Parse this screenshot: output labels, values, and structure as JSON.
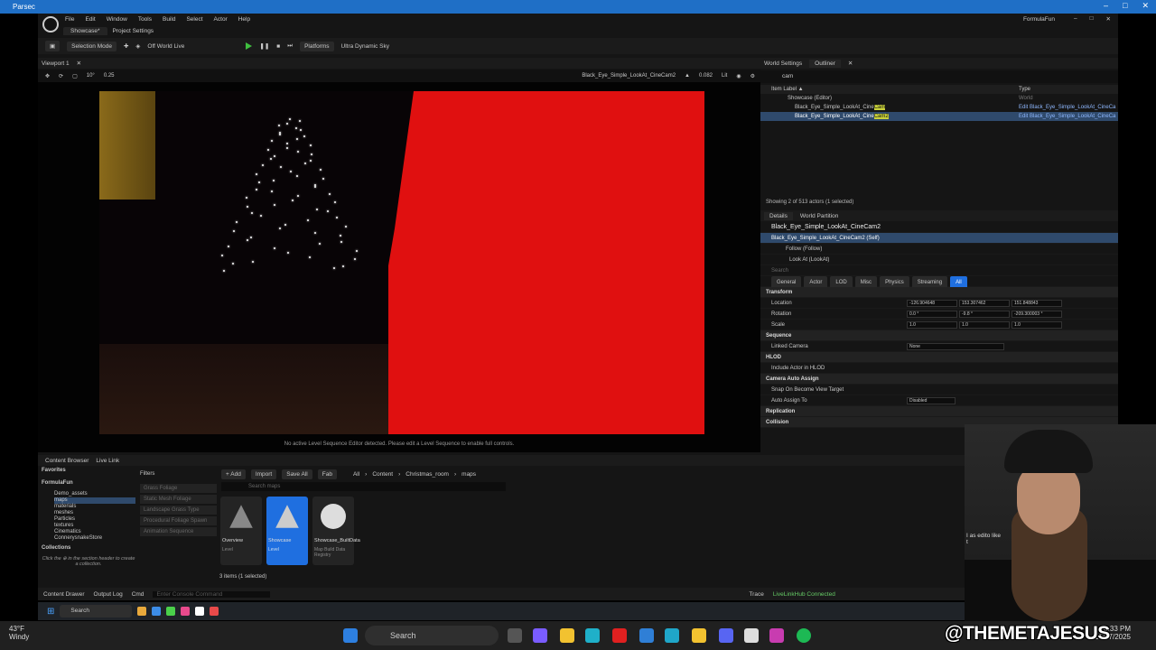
{
  "parsec": {
    "title": "Parsec",
    "controls": [
      "–",
      "□",
      "✕"
    ]
  },
  "menu": {
    "items": [
      "File",
      "Edit",
      "Window",
      "Tools",
      "Build",
      "Select",
      "Actor",
      "Help"
    ],
    "project": "FormulaFun"
  },
  "level_tab": "Showcase*",
  "project_settings": "Project Settings",
  "toolbar": {
    "selection_mode": "Selection Mode",
    "world": "Off World Live",
    "platforms": "Platforms",
    "sky": "Ultra Dynamic Sky"
  },
  "viewport": {
    "tab": "Viewport 1",
    "camera_name": "Black_Eye_Simple_LookAt_CineCam2",
    "fov_value": "0.082",
    "lit": "Lit",
    "grid_snap": "10°",
    "scale_snap": "0.25",
    "message": "No active Level Sequence Editor detected. Please edit a Level Sequence to enable full controls."
  },
  "right_tabs": {
    "world_settings": "World Settings",
    "outliner": "Outliner"
  },
  "outliner": {
    "search": "cam",
    "col_label": "Item Label ▲",
    "col_type": "Type",
    "rows": [
      {
        "label": "Showcase (Editor)",
        "type": "World",
        "selected": false
      },
      {
        "label": "Black_Eye_Simple_LookAt_Cine",
        "highlight": "Cam",
        "type": "Edit Black_Eye_Simple_LookAt_CineCa",
        "selected": false
      },
      {
        "label": "Black_Eye_Simple_LookAt_Cine",
        "highlight": "Cam2",
        "type": "Edit Black_Eye_Simple_LookAt_CineCa",
        "selected": true
      }
    ],
    "footer": "Showing 2 of 513 actors (1 selected)"
  },
  "details": {
    "tab": "Details",
    "tab2": "World Partition",
    "title": "Black_Eye_Simple_LookAt_CineCam2",
    "add": "+ Add",
    "self": "Black_Eye_Simple_LookAt_CineCam2 (Self)",
    "follow": "Follow (Follow)",
    "lookat": "Look At (LookAt)",
    "edit_cpp": "Edit in C++",
    "search_placeholder": "Search",
    "categories": [
      "General",
      "Actor",
      "LOD",
      "Misc",
      "Physics",
      "Streaming",
      "All"
    ],
    "transform": "Transform",
    "location_label": "Location",
    "location": [
      "-126.904648",
      "153.307462",
      "151.848843"
    ],
    "rotation_label": "Rotation",
    "rotation": [
      "0.0 °",
      "-9.8 °",
      "-209.300003 °"
    ],
    "scale_label": "Scale",
    "scale": [
      "1.0",
      "1.0",
      "1.0"
    ],
    "sequence": "Sequence",
    "linked_camera_label": "Linked Camera",
    "linked_camera": "None",
    "hlod": "HLOD",
    "include_hlod": "Include Actor in HLOD",
    "auto_assign": "Camera Auto Assign",
    "snap_label": "Snap On Become View Target",
    "assign_to_label": "Auto Assign To",
    "assign_to": "Disabled",
    "replication": "Replication",
    "collision": "Collision"
  },
  "content_browser": {
    "tab": "Content Browser",
    "tab2": "Live Link",
    "favorites": "Favorites",
    "root": "FormulaFun",
    "tree": [
      "Demo_assets",
      "maps",
      "materials",
      "meshes",
      "Particles",
      "textures",
      "Cinematics",
      "ConnerysnakeStore"
    ],
    "collections": "Collections",
    "collections_hint": "Click the ⊕ in the section header to create a collection.",
    "filters": "Filters",
    "filter_items": [
      "Grass Foliage",
      "Static Mesh Foliage",
      "Landscape Grass Type",
      "Procedural Foliage Spawn",
      "Animation Sequence"
    ],
    "add": "+ Add",
    "import": "Import",
    "save_all": "Save All",
    "fab": "Fab",
    "path": [
      "All",
      "Content",
      "Christmas_room",
      "maps"
    ],
    "search_placeholder": "Search maps",
    "assets": [
      {
        "name": "Overview",
        "type": "Level",
        "selected": false
      },
      {
        "name": "Showcase",
        "type": "Level",
        "selected": true
      },
      {
        "name": "Showcase_BuiltData",
        "type": "Map Build Data Registry",
        "selected": false
      }
    ],
    "count": "3 items (1 selected)"
  },
  "statusbar": {
    "drawer": "Content Drawer",
    "output": "Output Log",
    "cmd": "Cmd",
    "cmd_placeholder": "Enter Console Command",
    "trace": "Trace",
    "livelink": "LiveLinkHub Connected"
  },
  "taskbar": {
    "temp": "43°F",
    "weather": "Windy",
    "search": "Search",
    "time": "10:33 PM",
    "date": "12/27/2025",
    "inner_search": "Search"
  },
  "overlay_handle": "@THEMETAJESUS",
  "webcam_caption": "I as edito like t"
}
